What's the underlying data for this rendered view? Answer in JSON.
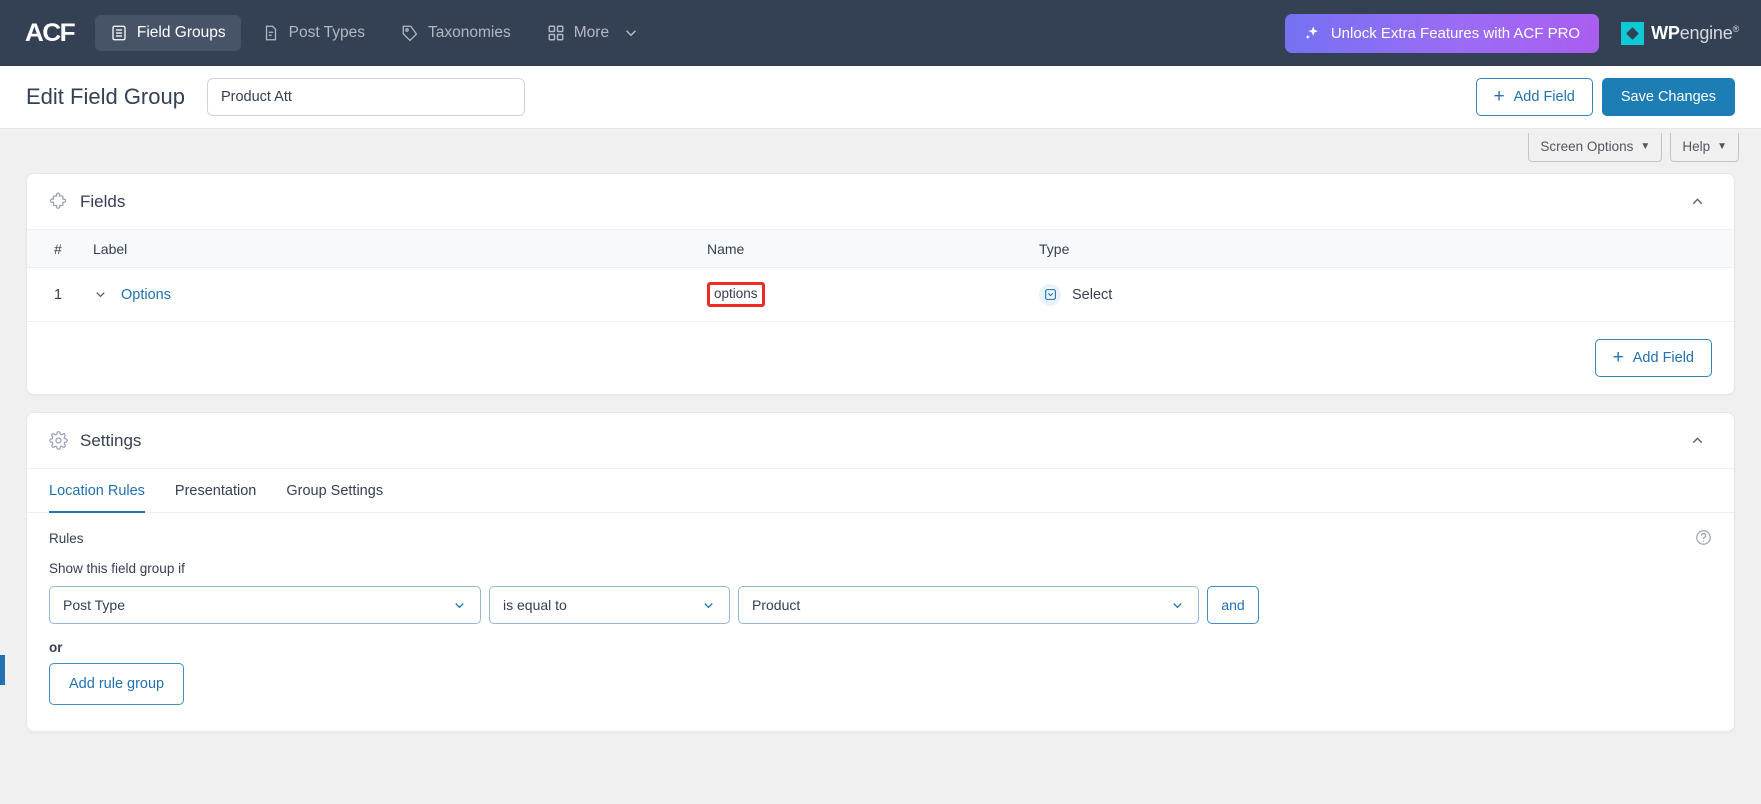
{
  "topbar": {
    "logo": "ACF",
    "nav": [
      {
        "label": "Field Groups",
        "icon": "field-groups-icon",
        "active": true
      },
      {
        "label": "Post Types",
        "icon": "post-types-icon",
        "active": false
      },
      {
        "label": "Taxonomies",
        "icon": "tag-icon",
        "active": false
      },
      {
        "label": "More",
        "icon": "grid-icon",
        "active": false
      }
    ],
    "pro_button": {
      "label": "Unlock Extra Features with ACF PRO",
      "icon": "sparkle-icon"
    },
    "wpengine": {
      "wp": "WP",
      "engine": "engine",
      "registered": "®"
    },
    "colors": {
      "bar_bg": "#344054",
      "pro_gradient_start": "#7571f2",
      "pro_gradient_end": "#a95ef0",
      "wpe_cyan": "#0ecad4"
    }
  },
  "subheader": {
    "title": "Edit Field Group",
    "title_input_value": "Product Att",
    "title_input_placeholder": "Add title",
    "add_field_label": "Add Field",
    "save_label": "Save Changes"
  },
  "screen_options": {
    "screen_options_label": "Screen Options",
    "help_label": "Help",
    "caret": "▼"
  },
  "fields_panel": {
    "title": "Fields",
    "icon": "puzzle-icon",
    "collapse_icon": "chevron-up-icon",
    "columns": [
      "#",
      "Label",
      "Name",
      "Type"
    ],
    "rows": [
      {
        "num": "1",
        "label": "Options",
        "name": "options",
        "type": "Select",
        "type_icon": "select-field-icon",
        "highlighted": true,
        "highlight_color": "#ee2b24"
      }
    ],
    "add_field_label": "Add Field"
  },
  "settings_panel": {
    "title": "Settings",
    "icon": "gear-icon",
    "collapse_icon": "chevron-up-icon",
    "tabs": [
      {
        "label": "Location Rules",
        "active": true
      },
      {
        "label": "Presentation",
        "active": false
      },
      {
        "label": "Group Settings",
        "active": false
      }
    ],
    "rules": {
      "heading": "Rules",
      "help_icon": "question-circle-icon",
      "subheading": "Show this field group if",
      "param_value": "Post Type",
      "operator_value": "is equal to",
      "value_value": "Product",
      "and_label": "and",
      "or_label": "or",
      "add_rule_group_label": "Add rule group"
    }
  }
}
